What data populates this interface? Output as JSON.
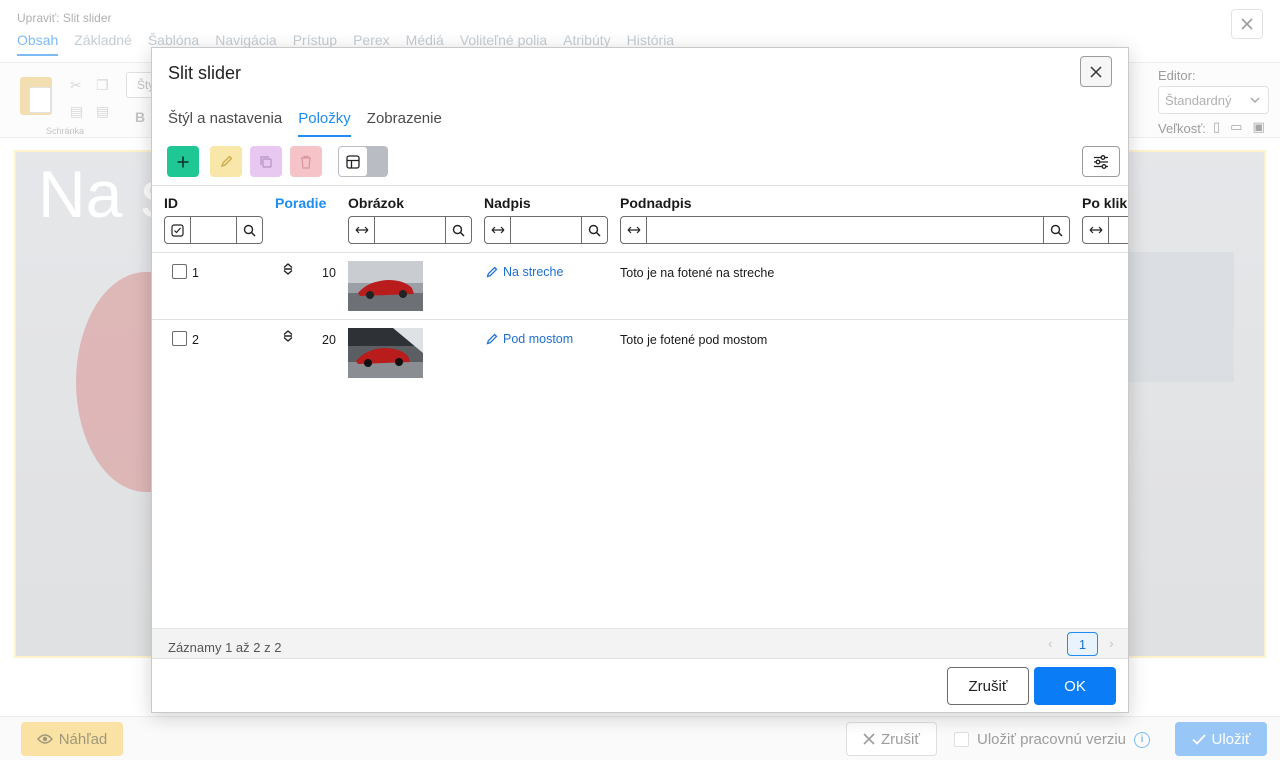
{
  "background": {
    "title": "Upraviť: Slit slider",
    "tabs": [
      {
        "label": "Obsah"
      },
      {
        "label": "Základné"
      },
      {
        "label": "Šablóna"
      },
      {
        "label": "Navigácia"
      },
      {
        "label": "Prístup"
      },
      {
        "label": "Perex"
      },
      {
        "label": "Médiá"
      },
      {
        "label": "Voliteľné polia"
      },
      {
        "label": "Atribúty"
      },
      {
        "label": "História"
      }
    ],
    "active_tab": "Obsah",
    "toolbar": {
      "clipboard_label": "Schránka",
      "style_placeholder": "Šty",
      "bold_label": "B",
      "editor_label": "Editor:",
      "editor_value": "Štandardný",
      "size_label": "Veľkosť:"
    },
    "canvas_heading": "Na s",
    "bottom": {
      "preview_label": "Náhľad",
      "cancel_label": "Zrušiť",
      "save_version_label": "Uložiť pracovnú verziu",
      "save_label": "Uložiť"
    }
  },
  "modal": {
    "title": "Slit slider",
    "tabs": [
      {
        "label": "Štýl a nastavenia"
      },
      {
        "label": "Položky"
      },
      {
        "label": "Zobrazenie"
      }
    ],
    "active_tab": "Položky",
    "columns": {
      "id": "ID",
      "order": "Poradie",
      "image": "Obrázok",
      "heading": "Nadpis",
      "subheading": "Podnadpis",
      "on_click": "Po klikn"
    },
    "rows": [
      {
        "id": "1",
        "order": "10",
        "heading": "Na streche",
        "subheading": "Toto je na fotené na streche"
      },
      {
        "id": "2",
        "order": "20",
        "heading": "Pod mostom",
        "subheading": "Toto je fotené pod mostom"
      }
    ],
    "footer": {
      "records": "Záznamy 1 až 2 z 2",
      "page": "1"
    },
    "buttons": {
      "cancel": "Zrušiť",
      "ok": "OK"
    }
  },
  "colors": {
    "accent": "#1e8cf0",
    "add_button": "#1ec794",
    "ok_button": "#0a7cf5",
    "preview_button": "#f5ce61"
  },
  "icons": [
    "close-icon",
    "plus-icon",
    "pencil-icon",
    "duplicate-icon",
    "trash-icon",
    "table-icon",
    "sliders-icon",
    "search-icon",
    "expand-icon",
    "checkbox-icon",
    "sort-icon",
    "eye-icon",
    "check-icon",
    "info-icon"
  ]
}
